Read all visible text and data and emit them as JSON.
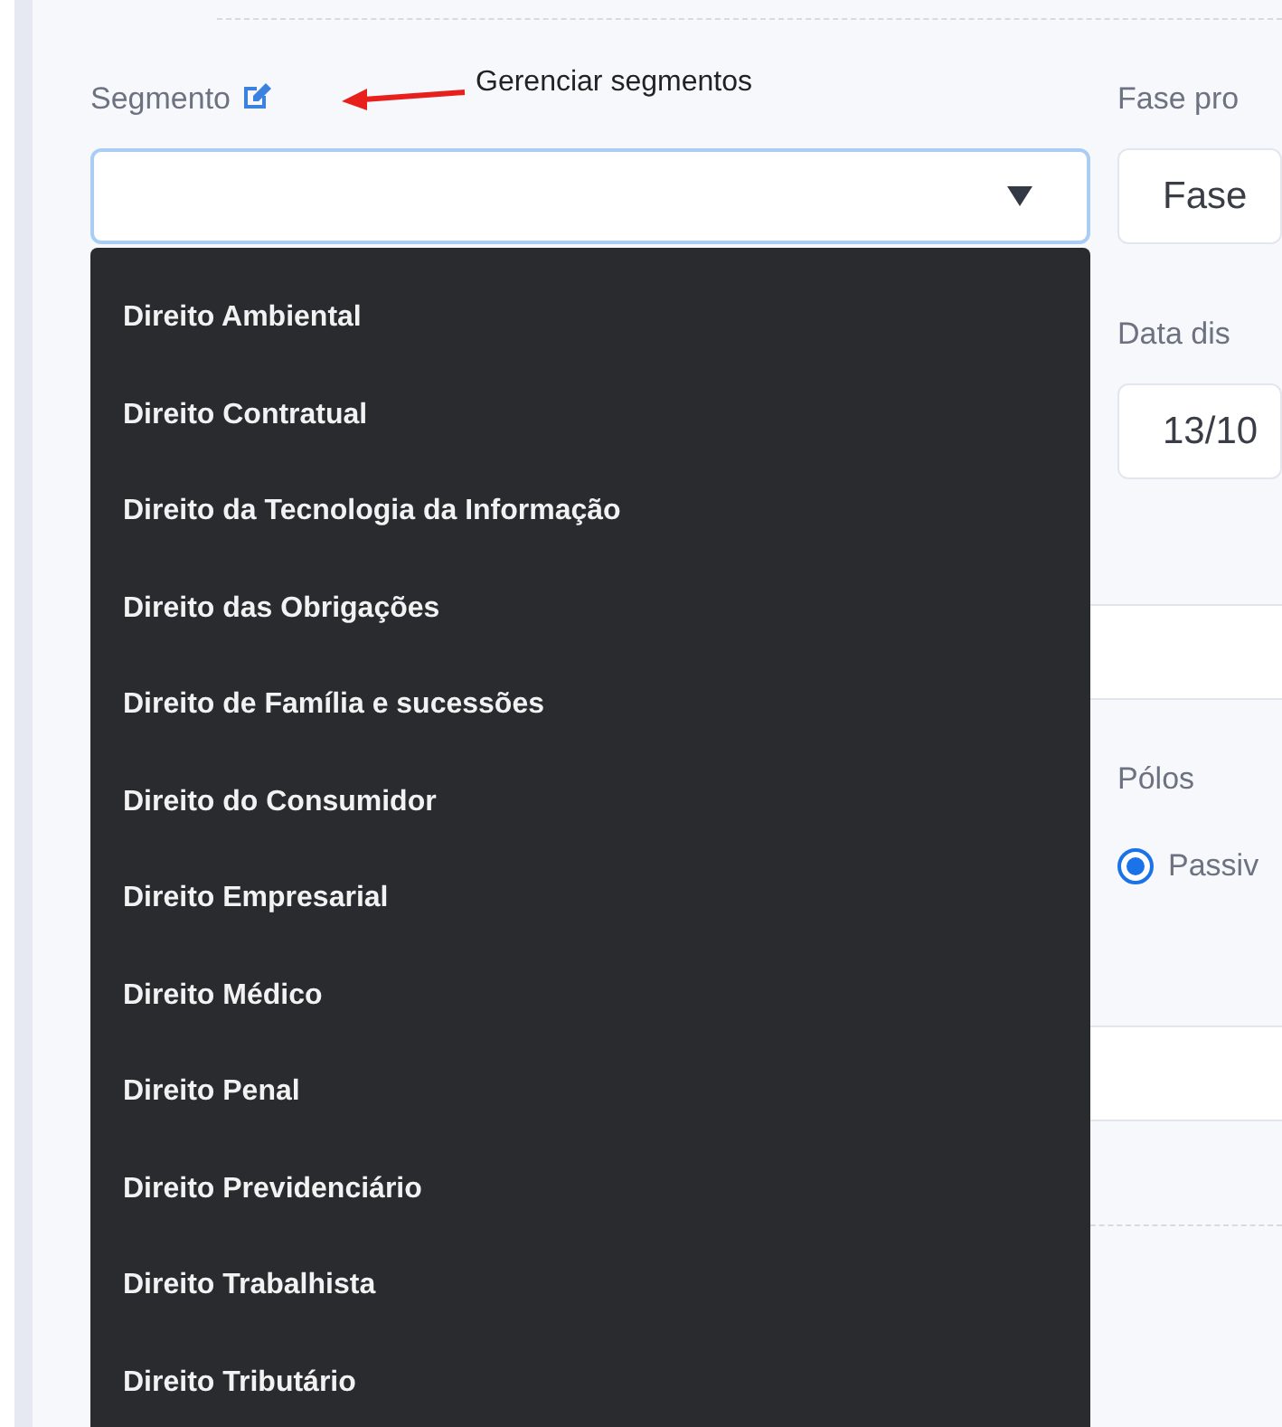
{
  "segment": {
    "label": "Segmento",
    "annotation": "Gerenciar segmentos",
    "expanded": true,
    "options": [
      {
        "label": "Direito Ambiental",
        "selected": false
      },
      {
        "label": "Direito Contratual",
        "selected": false
      },
      {
        "label": "Direito da Tecnologia da Informação",
        "selected": false
      },
      {
        "label": "Direito das Obrigações",
        "selected": false
      },
      {
        "label": "Direito de Família e sucessões",
        "selected": false
      },
      {
        "label": "Direito do Consumidor",
        "selected": false
      },
      {
        "label": "Direito Empresarial",
        "selected": false
      },
      {
        "label": "Direito Médico",
        "selected": false
      },
      {
        "label": "Direito Penal",
        "selected": false
      },
      {
        "label": "Direito Previdenciário",
        "selected": false
      },
      {
        "label": "Direito Trabalhista",
        "selected": false
      },
      {
        "label": "Direito Tributário",
        "selected": false
      }
    ]
  },
  "phase": {
    "label": "Fase pro",
    "value": "Fase"
  },
  "date": {
    "label": "Data dis",
    "value": "13/10"
  },
  "poles": {
    "label": "Pólos",
    "options": [
      {
        "label": "Passiv",
        "selected": true
      }
    ]
  }
}
